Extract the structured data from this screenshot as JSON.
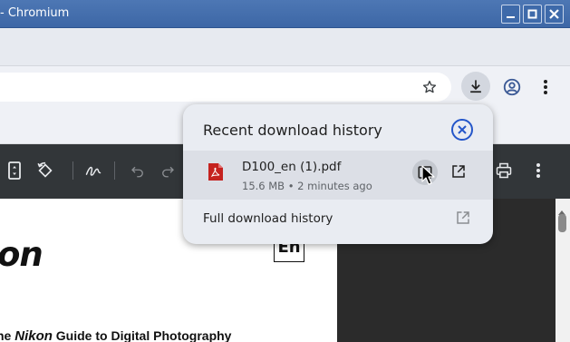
{
  "window": {
    "title": "- Chromium"
  },
  "pdf_document": {
    "brand_heading": "on",
    "language_label": "En",
    "subtitle_prefix": "he",
    "subtitle_brand": "Nikon",
    "subtitle_suffix": " Guide to Digital Photography"
  },
  "download_bubble": {
    "title": "Recent download history",
    "items": [
      {
        "file_name": "D100_en (1).pdf",
        "meta": "15.6 MB • 2 minutes ago",
        "file_type_icon": "pdf-file-icon"
      }
    ],
    "full_history_label": "Full download history"
  },
  "colors": {
    "titlebar": "#3d67a6",
    "accent": "#2456c9",
    "pdf_toolbar": "#323639",
    "pdf_icon": "#d93025"
  }
}
